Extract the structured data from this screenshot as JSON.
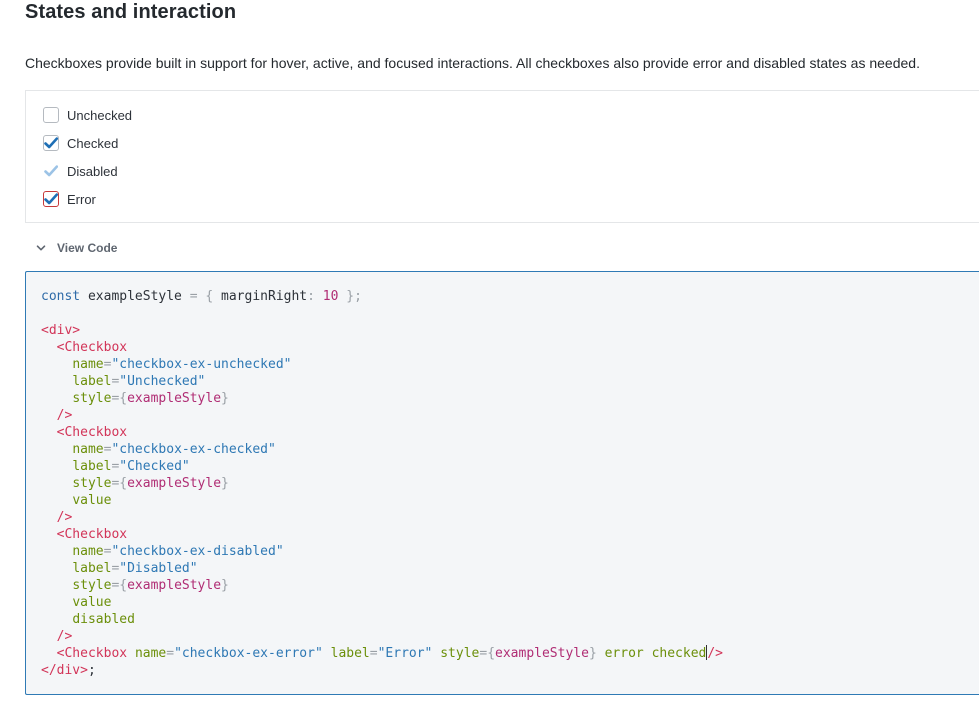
{
  "section": {
    "title": "States and interaction",
    "description": "Checkboxes provide built in support for hover, active, and focused interactions. All checkboxes also provide error and disabled states as needed."
  },
  "checkboxes": [
    {
      "label": "Unchecked",
      "state": "unchecked"
    },
    {
      "label": "Checked",
      "state": "checked"
    },
    {
      "label": "Disabled",
      "state": "disabled"
    },
    {
      "label": "Error",
      "state": "error"
    }
  ],
  "colors": {
    "check_blue": "#1f6fb5",
    "disabled_check": "#9cc3e6",
    "error_red": "#c73a3a",
    "panel_border_focus": "#2f7ab5"
  },
  "view_code": {
    "label": "View Code",
    "icon": "chevron-down-icon"
  },
  "code": {
    "const_kw": "const",
    "var_name": "exampleStyle",
    "eq": "=",
    "obj_open": "{",
    "prop": "marginRight",
    "colon": ":",
    "num": "10",
    "obj_close": "};",
    "div_open": "<div>",
    "tag_open": "<Checkbox",
    "tag_selfclose": "/>",
    "div_close": "</div>",
    "semicolon": ";",
    "attr_name": "name",
    "attr_label": "label",
    "attr_style": "style",
    "attr_value": "value",
    "attr_disabled": "disabled",
    "attr_error": "error",
    "attr_checked": "checked",
    "style_expr": "exampleStyle",
    "unchecked_name": "\"checkbox-ex-unchecked\"",
    "unchecked_label": "\"Unchecked\"",
    "checked_name": "\"checkbox-ex-checked\"",
    "checked_label": "\"Checked\"",
    "disabled_name": "\"checkbox-ex-disabled\"",
    "disabled_label": "\"Disabled\"",
    "error_name": "\"checkbox-ex-error\"",
    "error_label": "\"Error\""
  }
}
